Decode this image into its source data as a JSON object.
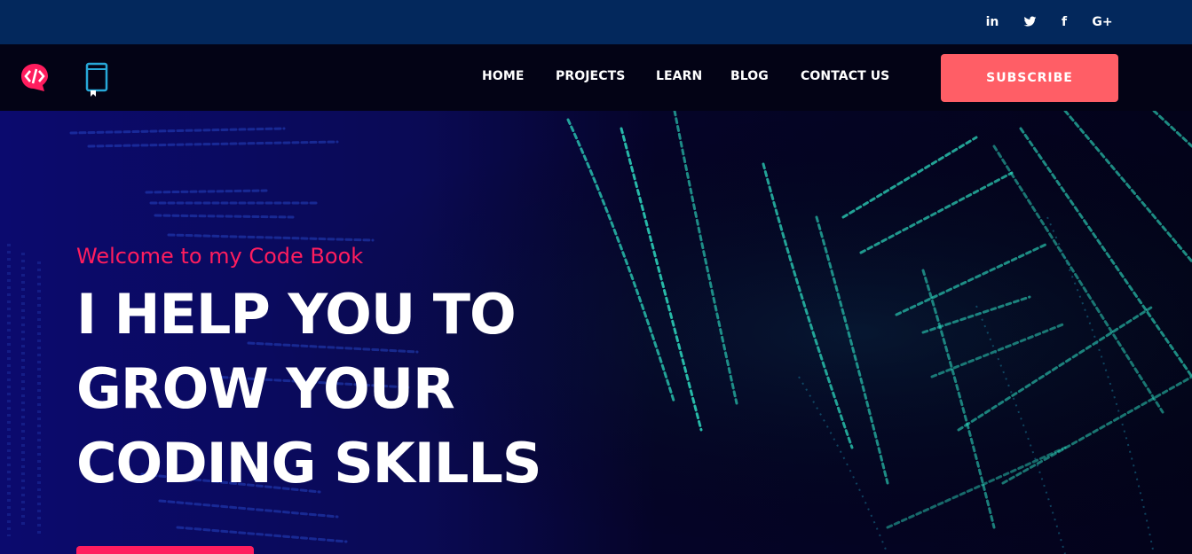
{
  "topbar": {
    "social": [
      {
        "name": "linkedin",
        "label": "in"
      },
      {
        "name": "twitter",
        "label": ""
      },
      {
        "name": "facebook",
        "label": "f"
      },
      {
        "name": "google-plus",
        "label": "G+"
      }
    ]
  },
  "nav": {
    "items": [
      "HOME",
      "PROJECTS",
      "LEARN",
      "BLOG",
      "CONTACT US"
    ],
    "subscribe_label": "SUBSCRIBE"
  },
  "hero": {
    "welcome": "Welcome to my Code Book",
    "headline": [
      "I HELP YOU TO",
      "GROW YOUR",
      "CODING SKILLS"
    ]
  },
  "colors": {
    "topbar": "#03285c",
    "navbar": "#030315",
    "accent": "#ff1d5e",
    "subscribe": "#ff5e66",
    "code_glow": "#2fe6c8"
  }
}
